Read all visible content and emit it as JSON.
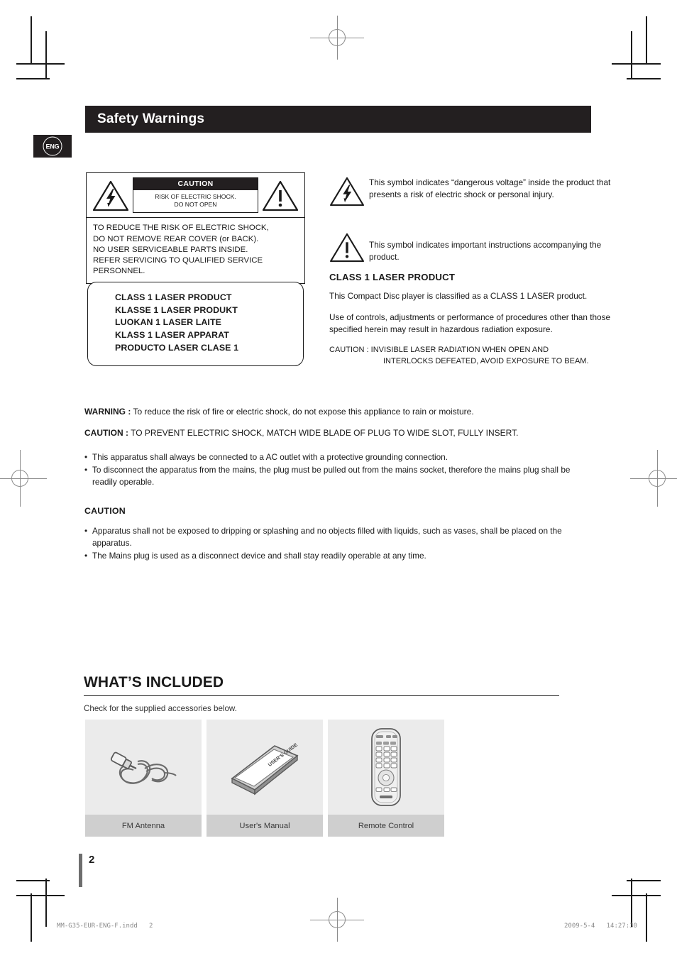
{
  "header": {
    "title": "Safety Warnings",
    "lang_badge": "ENG"
  },
  "caution_box": {
    "caution_label": "CAUTION",
    "risk_line1": "RISK OF ELECTRIC SHOCK.",
    "risk_line2": "DO NOT OPEN",
    "body_lines": [
      "TO REDUCE THE RISK OF ELECTRIC SHOCK,",
      "DO NOT REMOVE REAR COVER (or BACK).",
      "NO USER SERVICEABLE PARTS INSIDE.",
      "REFER SERVICING TO QUALIFIED SERVICE",
      "PERSONNEL."
    ]
  },
  "laser_box": {
    "lines": [
      "CLASS 1 LASER PRODUCT",
      "KLASSE 1 LASER PRODUKT",
      "LUOKAN 1 LASER LAITE",
      "KLASS 1 LASER APPARAT",
      "PRODUCTO LASER CLASE 1"
    ]
  },
  "symbols": [
    {
      "icon": "lightning-bolt-triangle-icon",
      "text": "This symbol indicates “dangerous voltage” inside the product that presents a risk of electric shock or personal injury."
    },
    {
      "icon": "exclamation-triangle-icon",
      "text": "This symbol indicates important instructions accompanying the product."
    }
  ],
  "laser_section": {
    "heading": "CLASS 1 LASER PRODUCT",
    "paragraph1": "This Compact Disc player is classified as a CLASS 1 LASER product.",
    "paragraph2": "Use of controls, adjustments or performance of procedures other than those specified herein may result in hazardous radiation exposure.",
    "caution_line1": "CAUTION : INVISIBLE LASER RADIATION WHEN OPEN AND",
    "caution_line2": "INTERLOCKS DEFEATED, AVOID EXPOSURE TO BEAM."
  },
  "warnings": {
    "warning_label": "WARNING :",
    "warning_text": " To reduce the risk of fire or electric shock, do not expose this appliance to rain or moisture.",
    "caution_label": "CAUTION :",
    "caution_text": " TO PREVENT ELECTRIC SHOCK, MATCH WIDE BLADE OF PLUG TO WIDE SLOT, FULLY INSERT.",
    "bullets": [
      "This apparatus shall always be connected to a AC outlet with a protective grounding connection.",
      "To disconnect the apparatus from the mains, the plug must be pulled out from the mains socket, therefore the mains plug shall be readily operable."
    ]
  },
  "caution_section": {
    "heading": "CAUTION",
    "bullets": [
      "Apparatus shall not be exposed to dripping or splashing and no objects filled with liquids, such as vases, shall be placed on the apparatus.",
      "The Mains plug is used as a disconnect device and shall stay readily operable at any time."
    ]
  },
  "included": {
    "heading": "WHAT’S INCLUDED",
    "subtitle": "Check for the supplied accessories below.",
    "items": [
      {
        "icon": "fm-antenna-icon",
        "label": "FM Antenna"
      },
      {
        "icon": "users-manual-icon",
        "label": "User's Manual"
      },
      {
        "icon": "remote-control-icon",
        "label": "Remote Control"
      }
    ]
  },
  "page": {
    "number": "2"
  },
  "footer": {
    "file": "MM-G35-EUR-ENG-F.indd   2",
    "timestamp": "2009-5-4   14:27:30"
  }
}
